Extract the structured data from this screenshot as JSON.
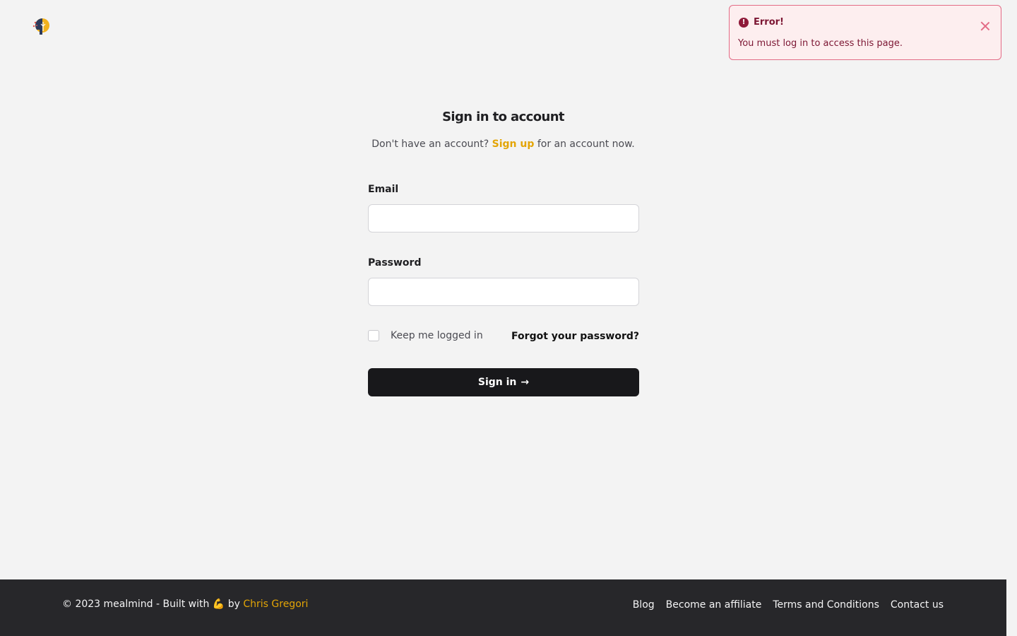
{
  "app": {
    "logo_icon": "mealmind-logo-icon"
  },
  "toast": {
    "title": "Error!",
    "message": "You must log in to access this page.",
    "icon": "error-icon",
    "close_icon": "close-icon",
    "colors": {
      "bg": "#fdeeef",
      "border": "#e36b86",
      "text": "#7c1633"
    }
  },
  "auth": {
    "title": "Sign in to account",
    "subtitle_before": "Don't have an account?",
    "signup_link": "Sign up",
    "subtitle_after": "for an account now.",
    "email_label": "Email",
    "email_value": "",
    "password_label": "Password",
    "password_value": "",
    "remember_label": "Keep me logged in",
    "remember_checked": false,
    "forgot_label": "Forgot your password?",
    "submit_label": "Sign in",
    "submit_arrow": "→"
  },
  "footer": {
    "copyright_prefix": "© 2023 mealmind - Built with",
    "emoji": "💪",
    "by": "by",
    "author": "Chris Gregori",
    "links": [
      "Blog",
      "Become an affiliate",
      "Terms and Conditions",
      "Contact us"
    ]
  },
  "colors": {
    "accent": "#e3a506",
    "button": "#18181b",
    "footer_bg": "#27272a",
    "page_bg": "#f3f3f3"
  }
}
